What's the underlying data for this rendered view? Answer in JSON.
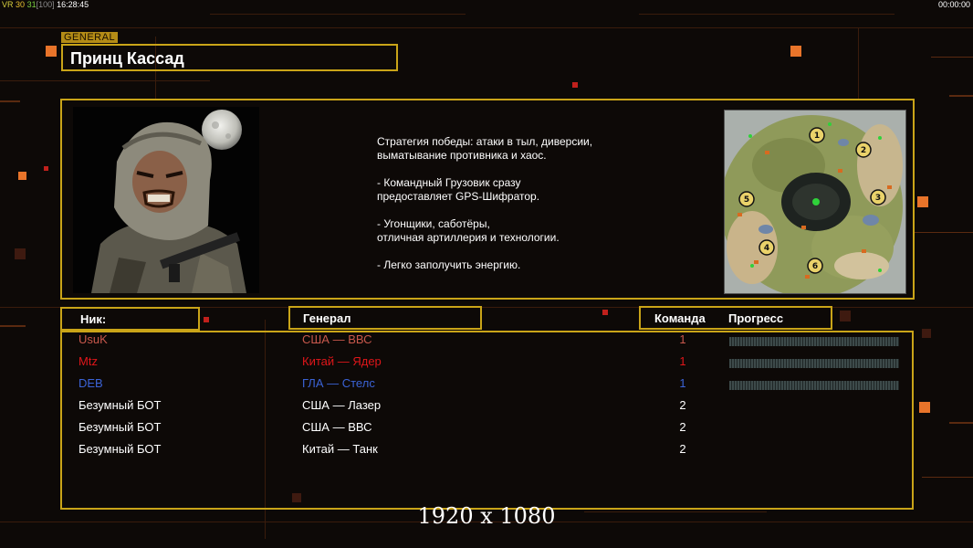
{
  "hud": {
    "vr": "VR",
    "num1": "30",
    "num2": "31",
    "bracket": "[100]",
    "clock": "16:28:45",
    "timer": "00:00:00"
  },
  "general_tag": "GENERAL",
  "general_name": "Принц Кассад",
  "description": "Стратегия победы: атаки в тыл, диверсии,\n выматывание противника и хаос.\n\n- Командный Грузовик сразу\nпредоставляет GPS-Шифратор.\n\n- Угонщики, саботёры,\nотличная артиллерия и технологии.\n\n- Легко заполучить энергию.",
  "map_positions": [
    "1",
    "2",
    "3",
    "4",
    "5",
    "6"
  ],
  "headers": {
    "nick": "Ник:",
    "general": "Генерал",
    "team": "Команда",
    "progress": "Прогресс"
  },
  "players": [
    {
      "nick": "UsuK",
      "general": "США — ВВС",
      "team": "1",
      "color": "#c8584c",
      "progress": 0
    },
    {
      "nick": "Mtz",
      "general": "Китай — Ядер",
      "team": "1",
      "color": "#e0161a",
      "progress": 0
    },
    {
      "nick": "DEB",
      "general": "ГЛА — Стелс",
      "team": "1",
      "color": "#3b63d6",
      "progress": 0
    },
    {
      "nick": "Безумный БОТ",
      "general": "США — Лазер",
      "team": "2",
      "color": "#ffffff"
    },
    {
      "nick": "Безумный БОТ",
      "general": "США — ВВС",
      "team": "2",
      "color": "#ffffff"
    },
    {
      "nick": "Безумный БОТ",
      "general": "Китай — Танк",
      "team": "2",
      "color": "#ffffff"
    }
  ],
  "resolution": "1920 x 1080",
  "colors": {
    "frame": "#c9a418",
    "accent": "#e8742a"
  }
}
